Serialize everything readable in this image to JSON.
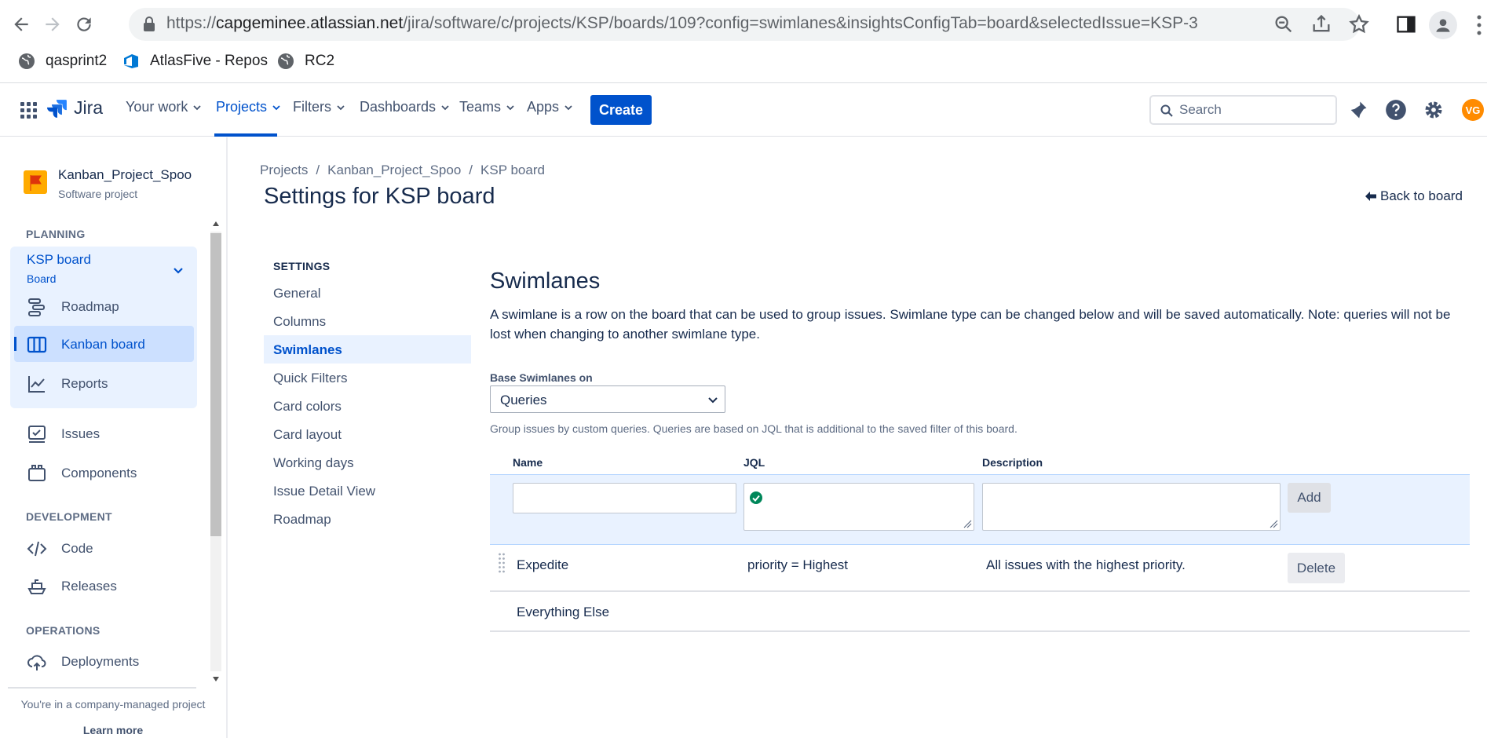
{
  "browser": {
    "url_domain": "capgeminee.atlassian.net",
    "url_prefix": "https://",
    "url_path": "/jira/software/c/projects/KSP/boards/109?config=swimlanes&insightsConfigTab=board&selectedIssue=KSP-3",
    "bookmarks": [
      {
        "label": "qasprint2",
        "icon": "globe-icon"
      },
      {
        "label": "AtlasFive - Repos",
        "icon": "azure-devops-icon"
      },
      {
        "label": "RC2",
        "icon": "globe-icon"
      }
    ]
  },
  "topnav": {
    "logo": "Jira",
    "items": [
      {
        "label": "Your work"
      },
      {
        "label": "Projects"
      },
      {
        "label": "Filters"
      },
      {
        "label": "Dashboards"
      },
      {
        "label": "Teams"
      },
      {
        "label": "Apps"
      }
    ],
    "active_item": "Projects",
    "create_label": "Create",
    "search_placeholder": "Search",
    "avatar_initials": "VG",
    "accent_color": "#0052cc"
  },
  "sidebar": {
    "project_name": "Kanban_Project_Spoo",
    "project_type": "Software project",
    "planning_heading": "PLANNING",
    "board_name": "KSP board",
    "board_sub": "Board",
    "planning_items": [
      {
        "label": "Roadmap",
        "icon": "roadmap-icon"
      },
      {
        "label": "Kanban board",
        "icon": "board-icon"
      },
      {
        "label": "Reports",
        "icon": "reports-icon"
      }
    ],
    "other_items": [
      {
        "label": "Issues",
        "icon": "issues-icon"
      },
      {
        "label": "Components",
        "icon": "components-icon"
      }
    ],
    "development_heading": "DEVELOPMENT",
    "development_items": [
      {
        "label": "Code",
        "icon": "code-icon"
      },
      {
        "label": "Releases",
        "icon": "releases-icon"
      }
    ],
    "operations_heading": "OPERATIONS",
    "operations_items": [
      {
        "label": "Deployments",
        "icon": "deployments-icon"
      }
    ],
    "company_note": "You're in a company-managed project",
    "learn_more": "Learn more"
  },
  "page": {
    "breadcrumb": [
      "Projects",
      "Kanban_Project_Spoo",
      "KSP board"
    ],
    "title": "Settings for KSP board",
    "back_link": "Back to board"
  },
  "settings_nav": {
    "heading": "SETTINGS",
    "items": [
      "General",
      "Columns",
      "Swimlanes",
      "Quick Filters",
      "Card colors",
      "Card layout",
      "Working days",
      "Issue Detail View",
      "Roadmap"
    ],
    "active": "Swimlanes"
  },
  "swimlanes": {
    "title": "Swimlanes",
    "description": "A swimlane is a row on the board that can be used to group issues. Swimlane type can be changed below and will be saved automatically. Note: queries will not be lost when changing to another swimlane type.",
    "base_label": "Base Swimlanes on",
    "base_value": "Queries",
    "help_text": "Group issues by custom queries. Queries are based on JQL that is additional to the saved filter of this board.",
    "columns": [
      "Name",
      "JQL",
      "Description"
    ],
    "add_label": "Add",
    "delete_label": "Delete",
    "rows": [
      {
        "name": "Expedite",
        "jql": "priority = Highest",
        "description": "All issues with the highest priority."
      },
      {
        "name": "Everything Else",
        "jql": "",
        "description": ""
      }
    ]
  }
}
